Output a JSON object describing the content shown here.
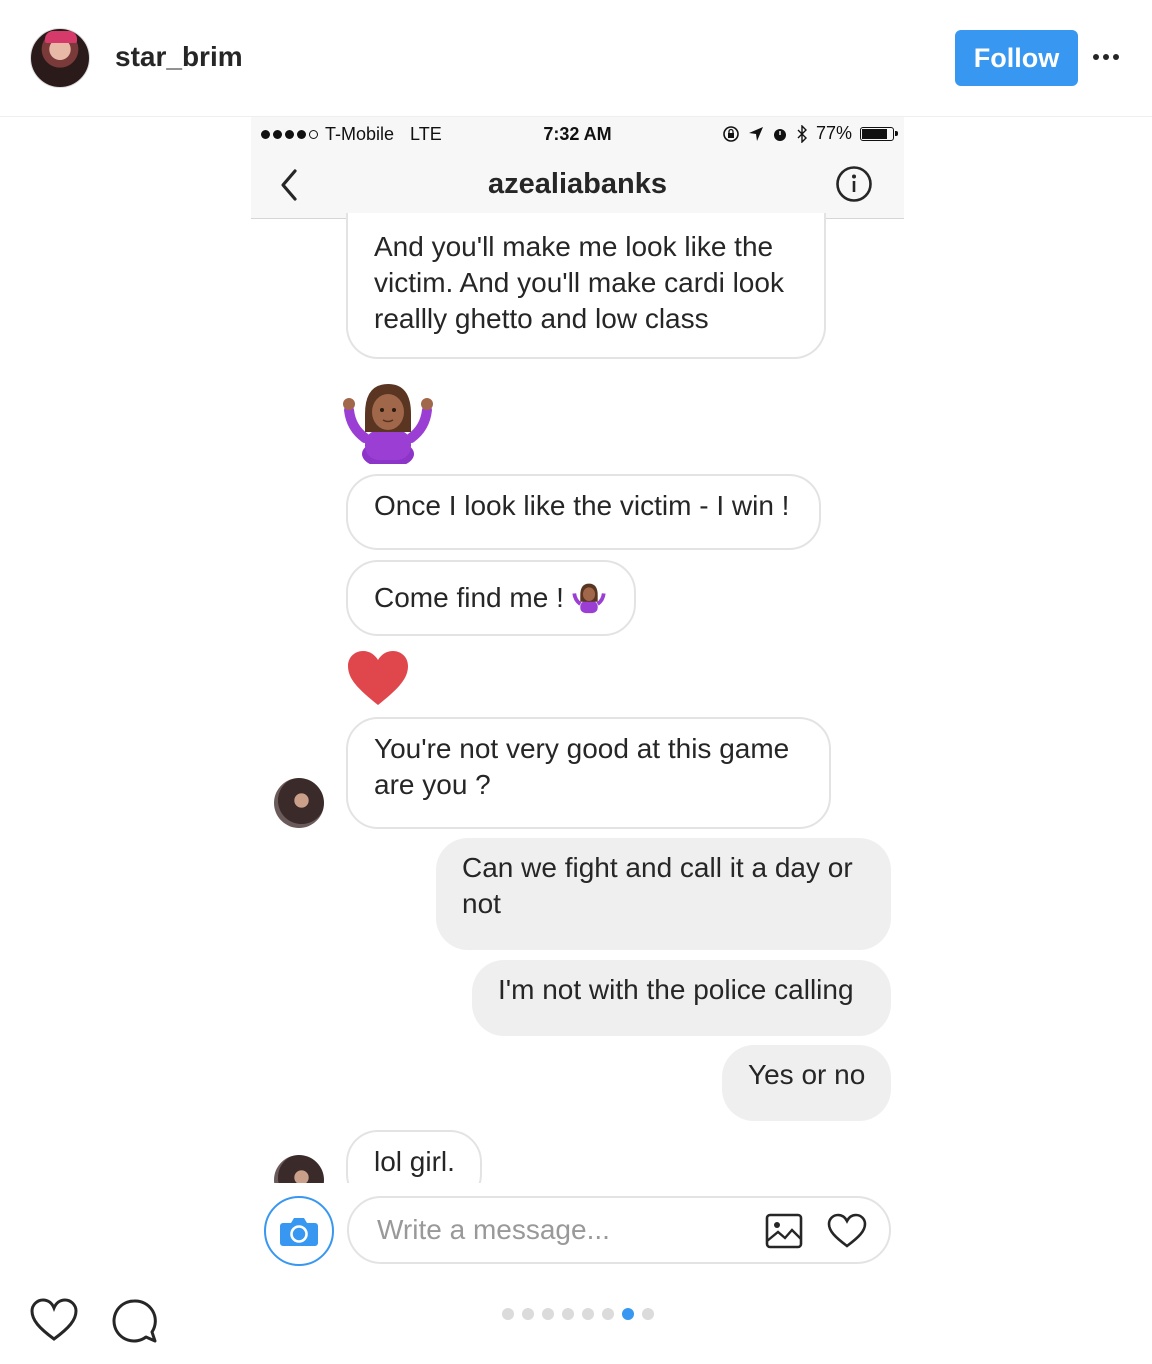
{
  "post": {
    "username": "star_brim",
    "follow_label": "Follow"
  },
  "phone": {
    "status": {
      "carrier": "T-Mobile",
      "network": "LTE",
      "time": "7:32 AM",
      "battery": "77%"
    },
    "conversation_title": "azealiabanks",
    "messages": [
      {
        "side": "in",
        "lines": [
          "And you'll make me look like the",
          "victim. And you'll make cardi look",
          "reallly ghetto and low class"
        ]
      },
      {
        "side": "in",
        "type": "emoji",
        "icon": "shrug-woman-emoji"
      },
      {
        "side": "in",
        "lines": [
          "Once I look like the victim - I win !"
        ]
      },
      {
        "side": "in",
        "lines": [
          "Come find me !"
        ],
        "emoji": "shrug-woman-emoji"
      },
      {
        "side": "in",
        "type": "heart",
        "color": "#e0474c"
      },
      {
        "side": "in",
        "lines": [
          "You're not very good at this game",
          "are you ?"
        ]
      },
      {
        "side": "out",
        "lines": [
          "Can we fight and call it a day or",
          "not"
        ]
      },
      {
        "side": "out",
        "lines": [
          "I'm not with the police calling"
        ]
      },
      {
        "side": "out",
        "lines": [
          "Yes or no"
        ]
      },
      {
        "side": "in",
        "lines": [
          "lol girl."
        ]
      }
    ],
    "composer_placeholder": "Write a message..."
  },
  "carousel": {
    "count": 8,
    "active_index": 6
  },
  "colors": {
    "accent": "#3897f0",
    "heart": "#e0474c",
    "bubble_out": "#efefef"
  }
}
